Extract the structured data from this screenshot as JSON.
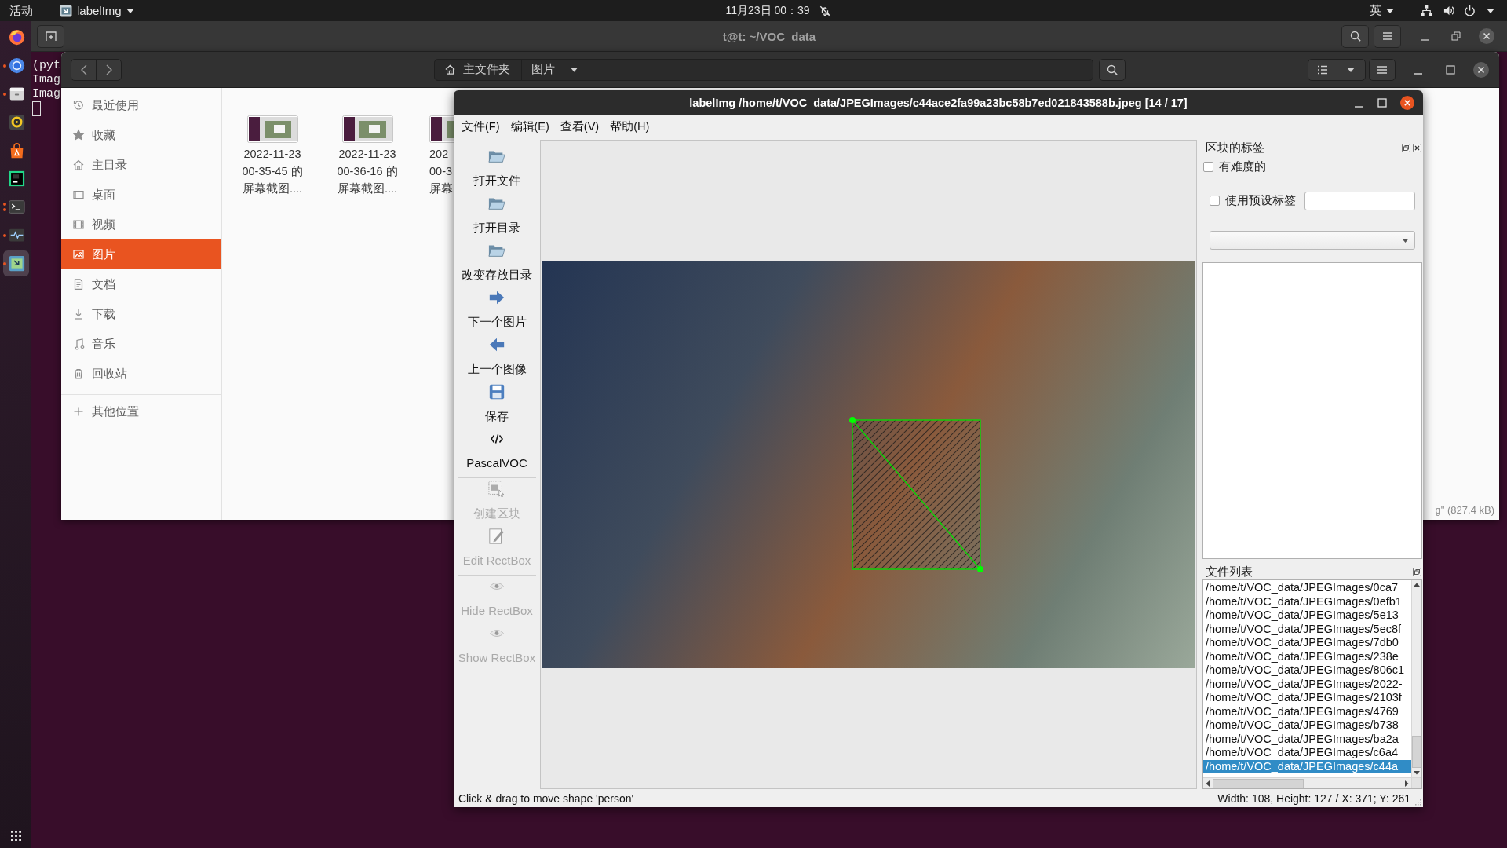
{
  "top_bar": {
    "activities": "活动",
    "app_menu": "labelImg",
    "clock": "11月23日 00：39",
    "input_method": "英"
  },
  "dock": {
    "items": [
      {
        "kind": "browser",
        "running": false,
        "multiple": false,
        "selected": false
      },
      {
        "kind": "web",
        "running": true,
        "multiple": false,
        "selected": false
      },
      {
        "kind": "files",
        "running": true,
        "multiple": false,
        "selected": false
      },
      {
        "kind": "music",
        "running": false,
        "multiple": false,
        "selected": false
      },
      {
        "kind": "store",
        "running": false,
        "multiple": false,
        "selected": false
      },
      {
        "kind": "ide",
        "running": false,
        "multiple": false,
        "selected": false
      },
      {
        "kind": "terminal",
        "running": true,
        "multiple": true,
        "selected": false
      },
      {
        "kind": "monitor",
        "running": true,
        "multiple": false,
        "selected": false
      },
      {
        "kind": "labeler",
        "running": true,
        "multiple": false,
        "selected": true
      }
    ]
  },
  "terminal": {
    "title": "t@t: ~/VOC_data",
    "lines": [
      "(pyt",
      "Imag",
      "Imag"
    ]
  },
  "file_manager": {
    "path": [
      {
        "label": "主文件夹",
        "kind": "home"
      },
      {
        "label": "图片",
        "kind": "dropdown"
      }
    ],
    "sidebar_sections": [
      {
        "items": [
          {
            "label": "最近使用",
            "kind": "recent",
            "selected": false
          },
          {
            "label": "收藏",
            "kind": "star",
            "selected": false
          },
          {
            "label": "主目录",
            "kind": "home",
            "selected": false
          },
          {
            "label": "桌面",
            "kind": "desktop",
            "selected": false
          },
          {
            "label": "视频",
            "kind": "video",
            "selected": false
          },
          {
            "label": "图片",
            "kind": "picture",
            "selected": true
          },
          {
            "label": "文档",
            "kind": "document",
            "selected": false
          },
          {
            "label": "下载",
            "kind": "download",
            "selected": false
          },
          {
            "label": "音乐",
            "kind": "music",
            "selected": false
          },
          {
            "label": "回收站",
            "kind": "trash",
            "selected": false
          }
        ]
      },
      {
        "items": [
          {
            "label": "其他位置",
            "kind": "plus",
            "selected": false
          }
        ]
      }
    ],
    "files": [
      {
        "lines": [
          "2022-11-23",
          "00-35-45 的",
          "屏幕截图...."
        ],
        "covered": false
      },
      {
        "lines": [
          "2022-11-23",
          "00-36-16 的",
          "屏幕截图...."
        ],
        "covered": false
      },
      {
        "lines": [
          "202",
          "00-3",
          "屏幕"
        ],
        "covered": true
      }
    ],
    "status": "g\" (827.4 kB)"
  },
  "labelimg": {
    "title": "labelImg /home/t/VOC_data/JPEGImages/c44ace2fa99a23bc58b7ed021843588b.jpeg [14 / 17]",
    "menu": [
      "文件(F)",
      "编辑(E)",
      "查看(V)",
      "帮助(H)"
    ],
    "tool_groups": [
      {
        "tools": [
          {
            "label": "打开文件",
            "kind": "folder",
            "disabled": false
          },
          {
            "label": "打开目录",
            "kind": "folder",
            "disabled": false
          },
          {
            "label": "改变存放目录",
            "kind": "folder",
            "disabled": false
          },
          {
            "label": "下一个图片",
            "kind": "next",
            "disabled": false
          },
          {
            "label": "上一个图像",
            "kind": "prev",
            "disabled": false
          },
          {
            "label": "保存",
            "kind": "save",
            "disabled": false
          },
          {
            "label": "PascalVOC",
            "kind": "code",
            "disabled": false
          }
        ]
      },
      {
        "tools": [
          {
            "label": "创建区块",
            "kind": "rect",
            "disabled": true
          },
          {
            "label": "Edit RectBox",
            "kind": "edit",
            "disabled": true
          }
        ]
      },
      {
        "tools": [
          {
            "label": "Hide RectBox",
            "kind": "eye",
            "disabled": true
          },
          {
            "label": "Show RectBox",
            "kind": "eye",
            "disabled": true
          }
        ]
      }
    ],
    "shape": {
      "selected": true
    },
    "box_labels": {
      "title": "区块的标签",
      "difficult": {
        "label": "有难度的",
        "checked": false
      },
      "use_default": {
        "label": "使用预设标签",
        "checked": false
      }
    },
    "file_list": {
      "title": "文件列表",
      "items": [
        {
          "path": "/home/t/VOC_data/JPEGImages/0ca7",
          "selected": false
        },
        {
          "path": "/home/t/VOC_data/JPEGImages/0efb1",
          "selected": false
        },
        {
          "path": "/home/t/VOC_data/JPEGImages/5e13",
          "selected": false
        },
        {
          "path": "/home/t/VOC_data/JPEGImages/5ec8f",
          "selected": false
        },
        {
          "path": "/home/t/VOC_data/JPEGImages/7db0",
          "selected": false
        },
        {
          "path": "/home/t/VOC_data/JPEGImages/238e",
          "selected": false
        },
        {
          "path": "/home/t/VOC_data/JPEGImages/806c1",
          "selected": false
        },
        {
          "path": "/home/t/VOC_data/JPEGImages/2022-",
          "selected": false
        },
        {
          "path": "/home/t/VOC_data/JPEGImages/2103f",
          "selected": false
        },
        {
          "path": "/home/t/VOC_data/JPEGImages/4769",
          "selected": false
        },
        {
          "path": "/home/t/VOC_data/JPEGImages/b738",
          "selected": false
        },
        {
          "path": "/home/t/VOC_data/JPEGImages/ba2a",
          "selected": false
        },
        {
          "path": "/home/t/VOC_data/JPEGImages/c6a4",
          "selected": false
        },
        {
          "path": "/home/t/VOC_data/JPEGImages/c44a",
          "selected": true
        }
      ]
    },
    "status": {
      "message": "Click & drag to move shape 'person'",
      "info": "Width: 108, Height: 127 / X: 371; Y: 261"
    }
  }
}
